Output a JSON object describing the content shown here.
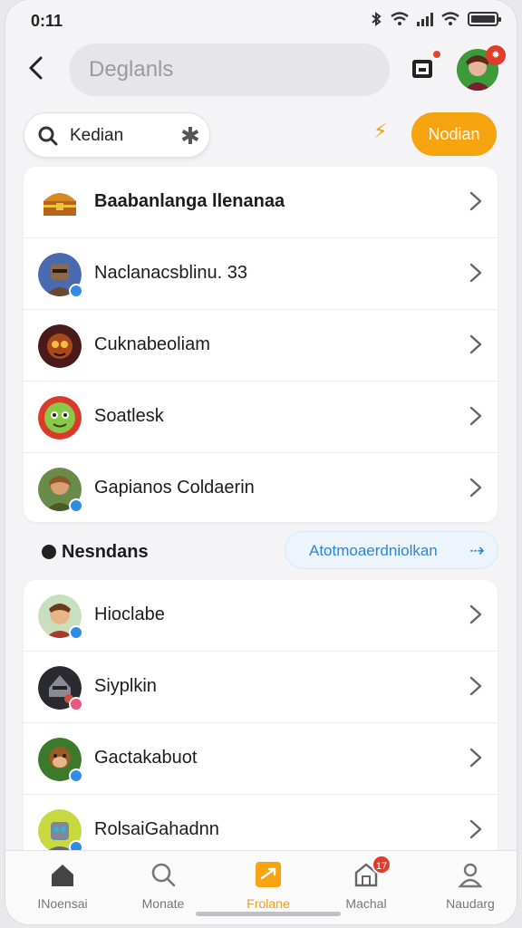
{
  "status_bar": {
    "time": "0:11"
  },
  "header": {
    "title": "Deglanls",
    "notification_badge": "",
    "avatar_badge": "✹"
  },
  "search": {
    "value": "Kedian",
    "action_label": "Nodian"
  },
  "list_top": [
    {
      "label": "Baabanlanga llenanaa",
      "bold": true,
      "avatar": "treasure-chest"
    },
    {
      "label": "Naclanacsblinu. 33",
      "avatar": "warrior"
    },
    {
      "label": "Cuknabeoliam",
      "avatar": "demon"
    },
    {
      "label": "Soatlesk",
      "avatar": "green-face"
    },
    {
      "label": "Gapianos Coldaerin",
      "avatar": "hunter"
    }
  ],
  "section": {
    "title": "Nesndans",
    "link_label": "Atotmoaerdniolkan",
    "link_arrow": "⇢"
  },
  "list_bottom": [
    {
      "label": "Hioclabe",
      "avatar": "elf"
    },
    {
      "label": "Siyplkin",
      "avatar": "knight"
    },
    {
      "label": "Gactakabuot",
      "avatar": "monkey"
    },
    {
      "label": "RolsaiGahadnn",
      "avatar": "robot"
    }
  ],
  "tabs": [
    {
      "label": "INoensai",
      "icon": "home-icon"
    },
    {
      "label": "Monate",
      "icon": "search-icon"
    },
    {
      "label": "Frolane",
      "icon": "plane-icon",
      "active": true
    },
    {
      "label": "Machal",
      "icon": "store-icon",
      "badge": "17"
    },
    {
      "label": "Naudarg",
      "icon": "person-icon"
    }
  ],
  "colors": {
    "accent": "#f6a310",
    "link": "#2d86d6",
    "badge": "#e23b2c"
  }
}
